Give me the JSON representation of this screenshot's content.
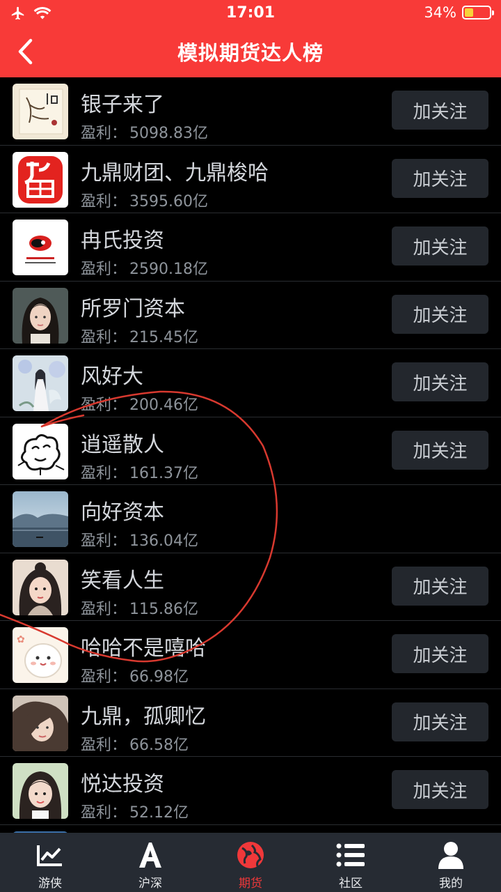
{
  "status_bar": {
    "time": "17:01",
    "battery": "34%",
    "battery_level": 0.34
  },
  "header": {
    "title": "模拟期货达人榜"
  },
  "colors": {
    "header_bg": "#f83a38",
    "accent": "#f0383a",
    "annotation": "#d8392f"
  },
  "profit_label": "盈利：",
  "rows": [
    {
      "name": "银子来了",
      "profit": "5098.83亿",
      "button": "加关注",
      "avatar": "ink-art-avatar"
    },
    {
      "name": "九鼎财团、九鼎梭哈",
      "profit": "3595.60亿",
      "button": "加关注",
      "avatar": "red-seal-avatar"
    },
    {
      "name": "冉氏投资",
      "profit": "2590.18亿",
      "button": "加关注",
      "avatar": "logo-avatar"
    },
    {
      "name": "所罗门资本",
      "profit": "215.45亿",
      "button": "加关注",
      "avatar": "portrait-avatar"
    },
    {
      "name": "风好大",
      "profit": "200.46亿",
      "button": "加关注",
      "avatar": "illustration-avatar"
    },
    {
      "name": "逍遥散人",
      "profit": "161.37亿",
      "button": "加关注",
      "avatar": "sketch-avatar"
    },
    {
      "name": "向好资本",
      "profit": "136.04亿",
      "button": "",
      "avatar": "landscape-avatar"
    },
    {
      "name": "笑看人生",
      "profit": "115.86亿",
      "button": "加关注",
      "avatar": "painting-avatar"
    },
    {
      "name": "哈哈不是嘻哈",
      "profit": "66.98亿",
      "button": "加关注",
      "avatar": "cartoon-avatar"
    },
    {
      "name": "九鼎，孤卿忆",
      "profit": "66.58亿",
      "button": "加关注",
      "avatar": "photo-avatar"
    },
    {
      "name": "悦达投资",
      "profit": "52.12亿",
      "button": "加关注",
      "avatar": "photo-avatar-2"
    }
  ],
  "tabs": [
    {
      "label": "游侠",
      "icon": "chart-line-icon"
    },
    {
      "label": "沪深",
      "icon": "letter-a-icon"
    },
    {
      "label": "期货",
      "icon": "globe-icon",
      "active": true
    },
    {
      "label": "社区",
      "icon": "list-icon"
    },
    {
      "label": "我的",
      "icon": "user-icon"
    }
  ]
}
